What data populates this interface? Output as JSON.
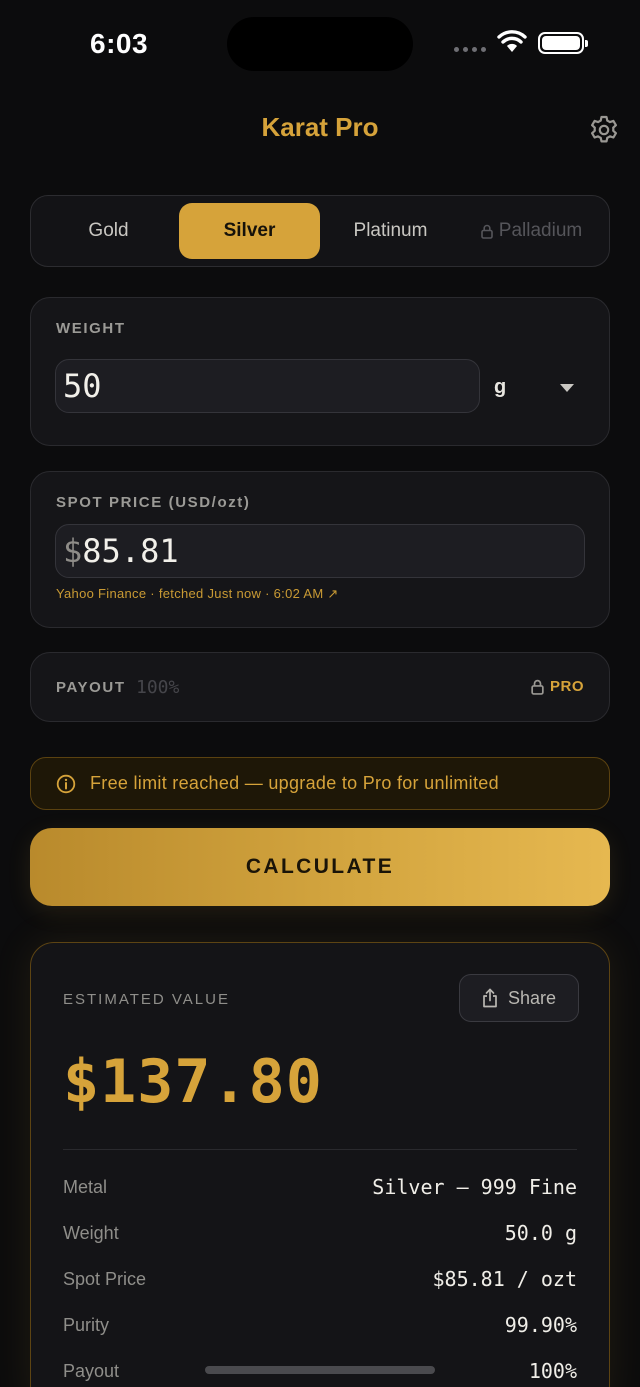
{
  "status_bar": {
    "time": "6:03"
  },
  "header": {
    "title": "Karat Pro"
  },
  "metals": {
    "tabs": [
      {
        "label": "Gold"
      },
      {
        "label": "Silver"
      },
      {
        "label": "Platinum"
      },
      {
        "label": "Palladium"
      }
    ],
    "selected": "Silver",
    "locked": [
      "Palladium"
    ]
  },
  "weight": {
    "label": "WEIGHT",
    "value": "50",
    "unit": "g"
  },
  "spot_price": {
    "label": "SPOT PRICE (USD/ozt)",
    "currency": "$",
    "value": "85.81",
    "source": "Yahoo Finance · fetched Just now · 6:02 AM ↗"
  },
  "payout": {
    "label": "PAYOUT",
    "placeholder": "100%",
    "badge": "PRO"
  },
  "warning": {
    "text": "Free limit reached — upgrade to Pro for unlimited"
  },
  "calculate": {
    "label": "CALCULATE"
  },
  "result": {
    "label": "ESTIMATED VALUE",
    "share_label": "Share",
    "value": "$137.80",
    "rows": [
      {
        "key": "Metal",
        "value": "Silver — 999 Fine"
      },
      {
        "key": "Weight",
        "value": "50.0 g"
      },
      {
        "key": "Spot Price",
        "value": "$85.81 / ozt"
      },
      {
        "key": "Purity",
        "value": "99.90%"
      },
      {
        "key": "Payout",
        "value": "100%"
      }
    ]
  },
  "colors": {
    "accent": "#d6a33a",
    "background": "#0c0c0d",
    "card": "#151518"
  },
  "icons": [
    "gear-icon",
    "lock-icon",
    "info-icon",
    "share-icon",
    "wifi-icon",
    "battery-icon",
    "chevron-down-icon"
  ]
}
